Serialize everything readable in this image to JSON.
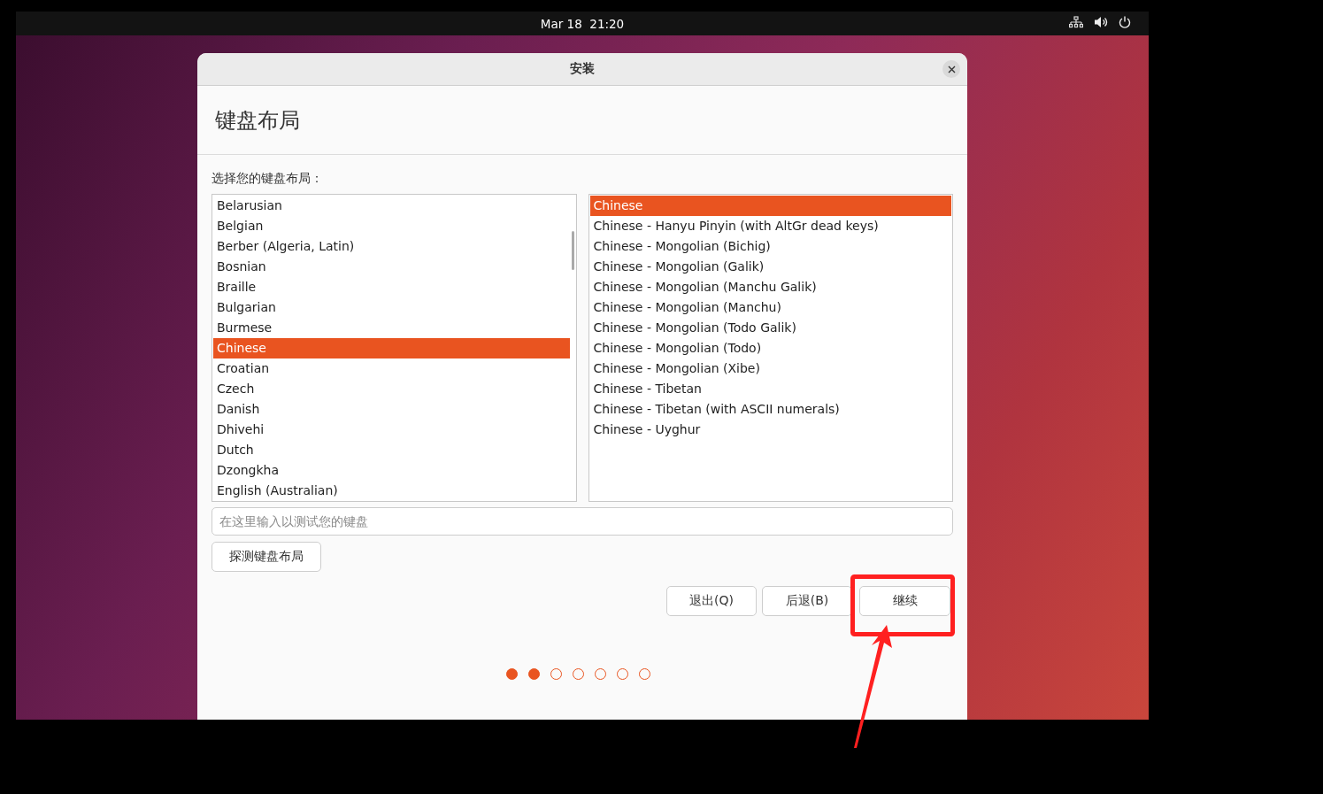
{
  "top_bar": {
    "clock": "Mar 18  21:20"
  },
  "window": {
    "title": "安装"
  },
  "heading": "键盘布局",
  "prompt": "选择您的键盘布局：",
  "layouts": [
    {
      "label": "Belarusian",
      "selected": false
    },
    {
      "label": "Belgian",
      "selected": false
    },
    {
      "label": "Berber (Algeria, Latin)",
      "selected": false
    },
    {
      "label": "Bosnian",
      "selected": false
    },
    {
      "label": "Braille",
      "selected": false
    },
    {
      "label": "Bulgarian",
      "selected": false
    },
    {
      "label": "Burmese",
      "selected": false
    },
    {
      "label": "Chinese",
      "selected": true
    },
    {
      "label": "Croatian",
      "selected": false
    },
    {
      "label": "Czech",
      "selected": false
    },
    {
      "label": "Danish",
      "selected": false
    },
    {
      "label": "Dhivehi",
      "selected": false
    },
    {
      "label": "Dutch",
      "selected": false
    },
    {
      "label": "Dzongkha",
      "selected": false
    },
    {
      "label": "English (Australian)",
      "selected": false
    }
  ],
  "variants": [
    {
      "label": "Chinese",
      "selected": true
    },
    {
      "label": "Chinese - Hanyu Pinyin (with AltGr dead keys)",
      "selected": false
    },
    {
      "label": "Chinese - Mongolian (Bichig)",
      "selected": false
    },
    {
      "label": "Chinese - Mongolian (Galik)",
      "selected": false
    },
    {
      "label": "Chinese - Mongolian (Manchu Galik)",
      "selected": false
    },
    {
      "label": "Chinese - Mongolian (Manchu)",
      "selected": false
    },
    {
      "label": "Chinese - Mongolian (Todo Galik)",
      "selected": false
    },
    {
      "label": "Chinese - Mongolian (Todo)",
      "selected": false
    },
    {
      "label": "Chinese - Mongolian (Xibe)",
      "selected": false
    },
    {
      "label": "Chinese - Tibetan",
      "selected": false
    },
    {
      "label": "Chinese - Tibetan (with ASCII numerals)",
      "selected": false
    },
    {
      "label": "Chinese - Uyghur",
      "selected": false
    }
  ],
  "test_field": {
    "placeholder": "在这里输入以测试您的键盘"
  },
  "detect_button": "探测键盘布局",
  "buttons": [
    {
      "label": "退出(Q)"
    },
    {
      "label": "后退(B)"
    },
    {
      "label": "继续"
    }
  ],
  "progress_dots": [
    {
      "completed": true
    },
    {
      "completed": true
    },
    {
      "completed": false
    },
    {
      "completed": false
    },
    {
      "completed": false
    },
    {
      "completed": false
    },
    {
      "completed": false
    }
  ]
}
